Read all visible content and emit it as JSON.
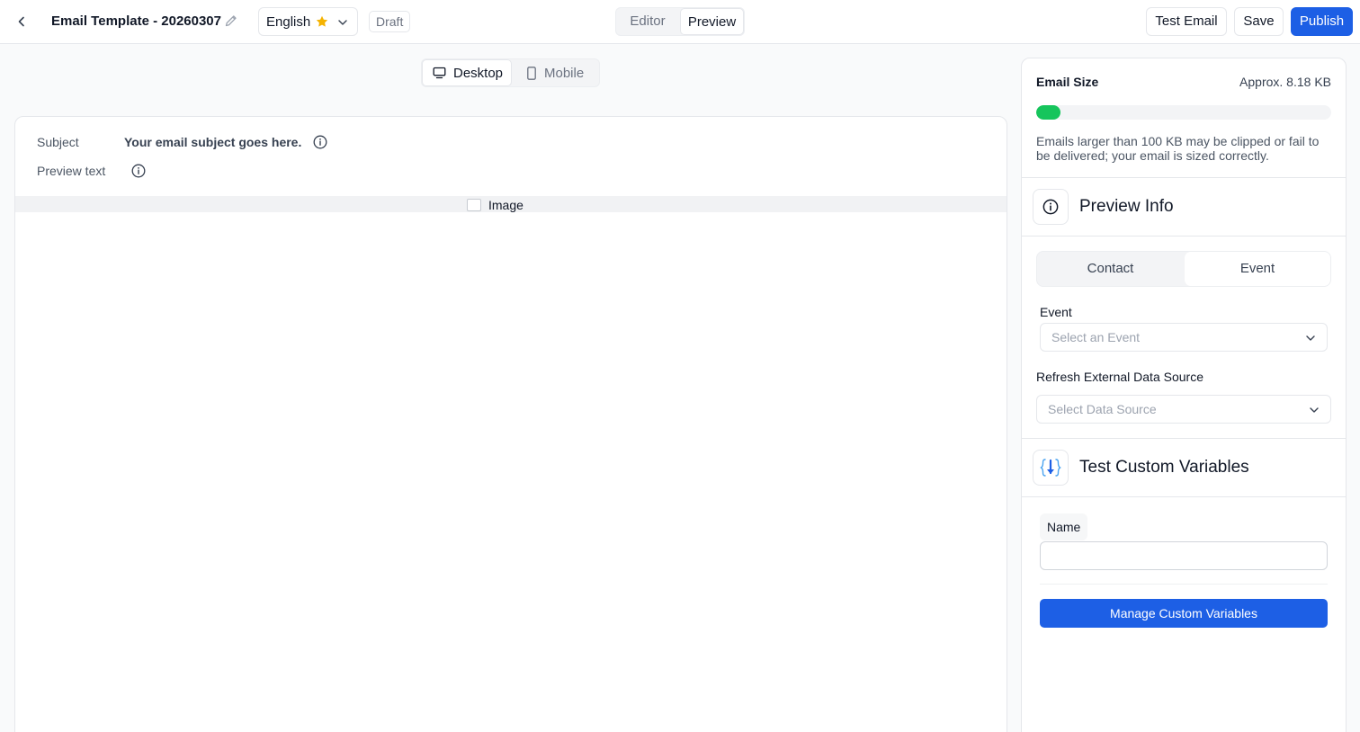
{
  "header": {
    "template_title": "Email Template - 20260307",
    "language": "English",
    "status": "Draft",
    "modes": [
      "Editor",
      "Preview"
    ],
    "active_mode": "Preview",
    "test_email_label": "Test Email",
    "save_label": "Save",
    "publish_label": "Publish"
  },
  "device": {
    "desktop_label": "Desktop",
    "mobile_label": "Mobile",
    "active": "Desktop"
  },
  "email": {
    "subject_label": "Subject",
    "subject_value": "Your email subject goes here.",
    "preview_text_label": "Preview text",
    "image_alt": "Image"
  },
  "panel": {
    "email_size_title": "Email Size",
    "email_size_value": "Approx. 8.18 KB",
    "size_progress_percent": 8.18,
    "size_note": "Emails larger than 100 KB may be clipped or fail to be delivered; your email is sized correctly.",
    "preview_info_title": "Preview Info",
    "tabs": [
      "Contact",
      "Event"
    ],
    "active_tab": "Event",
    "event_label": "Event",
    "event_placeholder": "Select an Event",
    "refresh_label": "Refresh External Data Source",
    "data_source_placeholder": "Select Data Source",
    "custom_vars_title": "Test Custom Variables",
    "name_label": "Name",
    "name_value": "",
    "manage_button_label": "Manage Custom Variables"
  },
  "colors": {
    "primary": "#1d5fe5",
    "progress": "#16c55c",
    "star": "#f5b301"
  },
  "icons": [
    "chevron-left-icon",
    "pencil-icon",
    "star-icon",
    "chevron-down-icon",
    "monitor-icon",
    "smartphone-icon",
    "info-icon",
    "braces-download-icon"
  ]
}
